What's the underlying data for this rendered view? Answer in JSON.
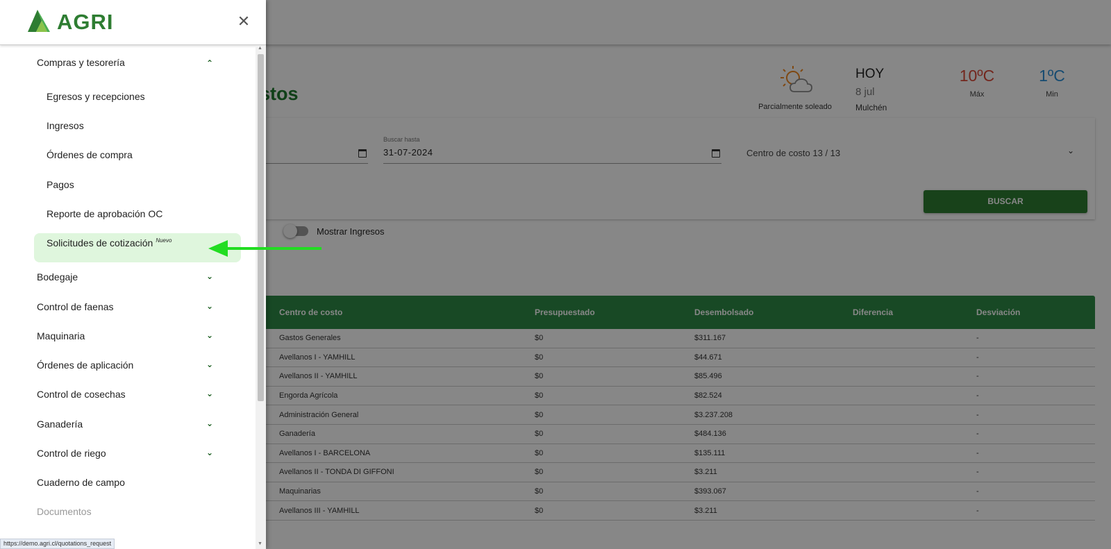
{
  "page": {
    "title": "e presupuestos",
    "weather": {
      "condition": "Parcialmente soleado",
      "today_label": "HOY",
      "date": "8 jul",
      "city": "Mulchén",
      "max_temp": "10ºC",
      "max_label": "Máx",
      "min_temp": "1ºC",
      "min_label": "Min"
    },
    "filters": {
      "hasta_label": "Buscar hasta",
      "hasta_value": "31-07-2024",
      "cost_center_value": "Centro de costo 13 / 13",
      "search_button": "BUSCAR",
      "toggle_label": "Mostrar Ingresos"
    },
    "table": {
      "headers": [
        "Centro de costo",
        "Presupuestado",
        "Desembolsado",
        "Diferencia",
        "Desviación"
      ],
      "rows": [
        [
          "Gastos Generales",
          "$0",
          "$311.167",
          "",
          "-"
        ],
        [
          "Avellanos I - YAMHILL",
          "$0",
          "$44.671",
          "",
          "-"
        ],
        [
          "Avellanos II - YAMHILL",
          "$0",
          "$85.496",
          "",
          "-"
        ],
        [
          "Engorda Agrícola",
          "$0",
          "$82.524",
          "",
          "-"
        ],
        [
          "Administración General",
          "$0",
          "$3.237.208",
          "",
          "-"
        ],
        [
          "Ganadería",
          "$0",
          "$484.136",
          "",
          "-"
        ],
        [
          "Avellanos I - BARCELONA",
          "$0",
          "$135.111",
          "",
          "-"
        ],
        [
          "Avellanos II - TONDA DI GIFFONI",
          "$0",
          "$3.211",
          "",
          "-"
        ],
        [
          "Maquinarias",
          "$0",
          "$393.067",
          "",
          "-"
        ],
        [
          "Avellanos III - YAMHILL",
          "$0",
          "$3.211",
          "",
          "-"
        ]
      ]
    }
  },
  "drawer": {
    "logo_text": "AGRI",
    "close_icon": "close-icon",
    "sections": {
      "compras": "Compras y tesorería",
      "bodegaje": "Bodegaje",
      "faenas": "Control de faenas",
      "maquinaria": "Maquinaria",
      "aplicacion": "Órdenes de aplicación",
      "cosechas": "Control de cosechas",
      "ganaderia": "Ganadería",
      "riego": "Control de riego",
      "cuaderno": "Cuaderno de campo",
      "documentos": "Documentos"
    },
    "compras_items": {
      "egresos": "Egresos y recepciones",
      "ingresos": "Ingresos",
      "ordenes": "Órdenes de compra",
      "pagos": "Pagos",
      "reporte": "Reporte de aprobación OC",
      "solicitudes": "Solicitudes de cotización",
      "solicitudes_badge": "Nuevo"
    }
  },
  "status_bar": {
    "url": "https://demo.agri.cl/quotations_request"
  },
  "colors": {
    "brand_green": "#2e7d32",
    "highlight_green": "#dff6dd",
    "arrow_green": "#22dd22",
    "max_temp": "#d94a3a",
    "min_temp": "#2a8fd6"
  }
}
